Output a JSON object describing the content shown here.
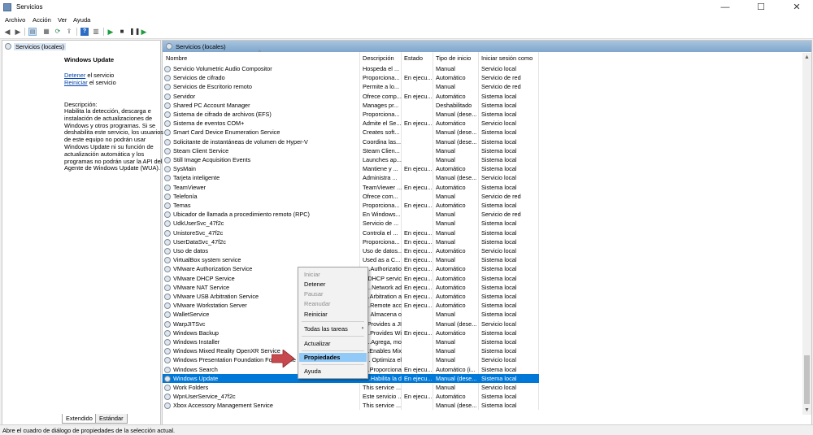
{
  "window": {
    "title": "Servicios"
  },
  "window_controls": {
    "minimize": "—",
    "maximize": "☐",
    "close": "✕"
  },
  "menu": [
    "Archivo",
    "Acción",
    "Ver",
    "Ayuda"
  ],
  "tree": {
    "item": "Servicios (locales)"
  },
  "pane": {
    "header": "Servicios (locales)"
  },
  "detail": {
    "service_name": "Windows Update",
    "stop_link": "Detener",
    "stop_suffix": " el servicio",
    "restart_link": "Reiniciar",
    "restart_suffix": " el servicio",
    "desc_label": "Descripción:",
    "desc_lines": [
      "Habilita la detección, descarga e",
      "instalación de actualizaciones de",
      "Windows y otros programas. Si se",
      "deshabilita este servicio, los usuarios",
      "de este equipo no podrán usar",
      "Windows Update ni su función de",
      "actualización automática y los",
      "programas no podrán usar la API del",
      "Agente de Windows Update (WUA)."
    ]
  },
  "columns": [
    "Nombre",
    "Descripción",
    "Estado",
    "Tipo de inicio",
    "Iniciar sesión como"
  ],
  "rows": [
    [
      "Servicio Volumetric Audio Compositor",
      "Hospeda el ...",
      "",
      "Manual",
      "Servicio local"
    ],
    [
      "Servicios de cifrado",
      "Proporciona...",
      "En ejecu...",
      "Automático",
      "Servicio de red"
    ],
    [
      "Servicios de Escritorio remoto",
      "Permite a lo...",
      "",
      "Manual",
      "Servicio de red"
    ],
    [
      "Servidor",
      "Ofrece comp...",
      "En ejecu...",
      "Automático",
      "Sistema local"
    ],
    [
      "Shared PC Account Manager",
      "Manages pr...",
      "",
      "Deshabilitado",
      "Sistema local"
    ],
    [
      "Sistema de cifrado de archivos (EFS)",
      "Proporciona...",
      "",
      "Manual (dese...",
      "Sistema local"
    ],
    [
      "Sistema de eventos COM+",
      "Admite el Se...",
      "En ejecu...",
      "Automático",
      "Servicio local"
    ],
    [
      "Smart Card Device Enumeration Service",
      "Creates soft...",
      "",
      "Manual (dese...",
      "Sistema local"
    ],
    [
      "Solicitante de instantáneas de volumen de Hyper-V",
      "Coordina las...",
      "",
      "Manual (dese...",
      "Sistema local"
    ],
    [
      "Steam Client Service",
      "Steam Clien...",
      "",
      "Manual",
      "Sistema local"
    ],
    [
      "Still Image Acquisition Events",
      "Launches ap...",
      "",
      "Manual",
      "Sistema local"
    ],
    [
      "SysMain",
      "Mantiene y ...",
      "En ejecu...",
      "Automático",
      "Sistema local"
    ],
    [
      "Tarjeta inteligente",
      "Administra ...",
      "",
      "Manual (dese...",
      "Servicio local"
    ],
    [
      "TeamViewer",
      "TeamViewer ...",
      "En ejecu...",
      "Automático",
      "Sistema local"
    ],
    [
      "Telefonía",
      "Ofrece com...",
      "",
      "Manual",
      "Servicio de red"
    ],
    [
      "Temas",
      "Proporciona...",
      "En ejecu...",
      "Automático",
      "Sistema local"
    ],
    [
      "Ubicador de llamada a procedimiento remoto (RPC)",
      "En Windows...",
      "",
      "Manual",
      "Servicio de red"
    ],
    [
      "UdkUserSvc_47f2c",
      "Servicio de ...",
      "",
      "Manual",
      "Sistema local"
    ],
    [
      "UnistoreSvc_47f2c",
      "Controla el ...",
      "En ejecu...",
      "Manual",
      "Sistema local"
    ],
    [
      "UserDataSvc_47f2c",
      "Proporciona...",
      "En ejecu...",
      "Manual",
      "Sistema local"
    ],
    [
      "Uso de datos",
      "Uso de datos...",
      "En ejecu...",
      "Automático",
      "Servicio local"
    ],
    [
      "VirtualBox system service",
      "Used as a C...",
      "En ejecu...",
      "Manual",
      "Sistema local"
    ],
    [
      "VMware Authorization Service",
      "Authorizatio...",
      "En ejecu...",
      "Automático",
      "Sistema local"
    ],
    [
      "VMware DHCP Service",
      "DHCP servic...",
      "En ejecu...",
      "Automático",
      "Sistema local"
    ],
    [
      "VMware NAT Service",
      "Network ad...",
      "En ejecu...",
      "Automático",
      "Sistema local"
    ],
    [
      "VMware USB Arbitration Service",
      "Arbitration a...",
      "En ejecu...",
      "Automático",
      "Sistema local"
    ],
    [
      "VMware Workstation Server",
      "Remote acc...",
      "En ejecu...",
      "Automático",
      "Sistema local"
    ],
    [
      "WalletService",
      "Almacena o ...",
      "",
      "Manual",
      "Sistema local"
    ],
    [
      "WarpJITSvc",
      "Provides a JI...",
      "",
      "Manual (dese...",
      "Servicio local"
    ],
    [
      "Windows Backup",
      "Provides Wi...",
      "En ejecu...",
      "Automático",
      "Sistema local"
    ],
    [
      "Windows Installer",
      "Agrega, mo...",
      "",
      "Manual",
      "Sistema local"
    ],
    [
      "Windows Mixed Reality OpenXR Service",
      "Enables Mix...",
      "",
      "Manual",
      "Sistema local"
    ],
    [
      "Windows Presentation Foundation Font Cache 3.0.0.0",
      "Optimiza el ...",
      "",
      "Manual",
      "Servicio local"
    ],
    [
      "Windows Search",
      "Proporciona...",
      "En ejecu...",
      "Automático (i...",
      "Sistema local"
    ],
    [
      "Windows Update",
      "Habilita la d...",
      "En ejecu...",
      "Manual (dese...",
      "Sistema local"
    ],
    [
      "Work Folders",
      "This service ...",
      "",
      "Manual",
      "Servicio local"
    ],
    [
      "WpnUserService_47f2c",
      "Este servicio ...",
      "En ejecu...",
      "Automático",
      "Sistema local"
    ],
    [
      "Xbox Accessory Management Service",
      "This service ...",
      "",
      "Manual (dese...",
      "Sistema local"
    ]
  ],
  "selected_row": "Windows Update",
  "context_menu": [
    {
      "label": "Iniciar",
      "state": "disabled"
    },
    {
      "label": "Detener",
      "state": "enabled"
    },
    {
      "label": "Pausar",
      "state": "disabled"
    },
    {
      "label": "Reanudar",
      "state": "disabled"
    },
    {
      "label": "Reiniciar",
      "state": "enabled"
    },
    {
      "label": "Todas las tareas",
      "state": "submenu"
    },
    {
      "label": "Actualizar",
      "state": "enabled"
    },
    {
      "label": "Propiedades",
      "state": "highlighted"
    },
    {
      "label": "Ayuda",
      "state": "enabled"
    }
  ],
  "tabs": [
    "Extendido",
    "Estándar"
  ],
  "status": "Abre el cuadro de diálogo de propiedades de la selección actual.",
  "colors": {
    "selection": "#0078d7",
    "menu_highlight": "#91c9f7",
    "pane_header": "#a8c4df",
    "pointer_arrow": "#c8494d"
  }
}
